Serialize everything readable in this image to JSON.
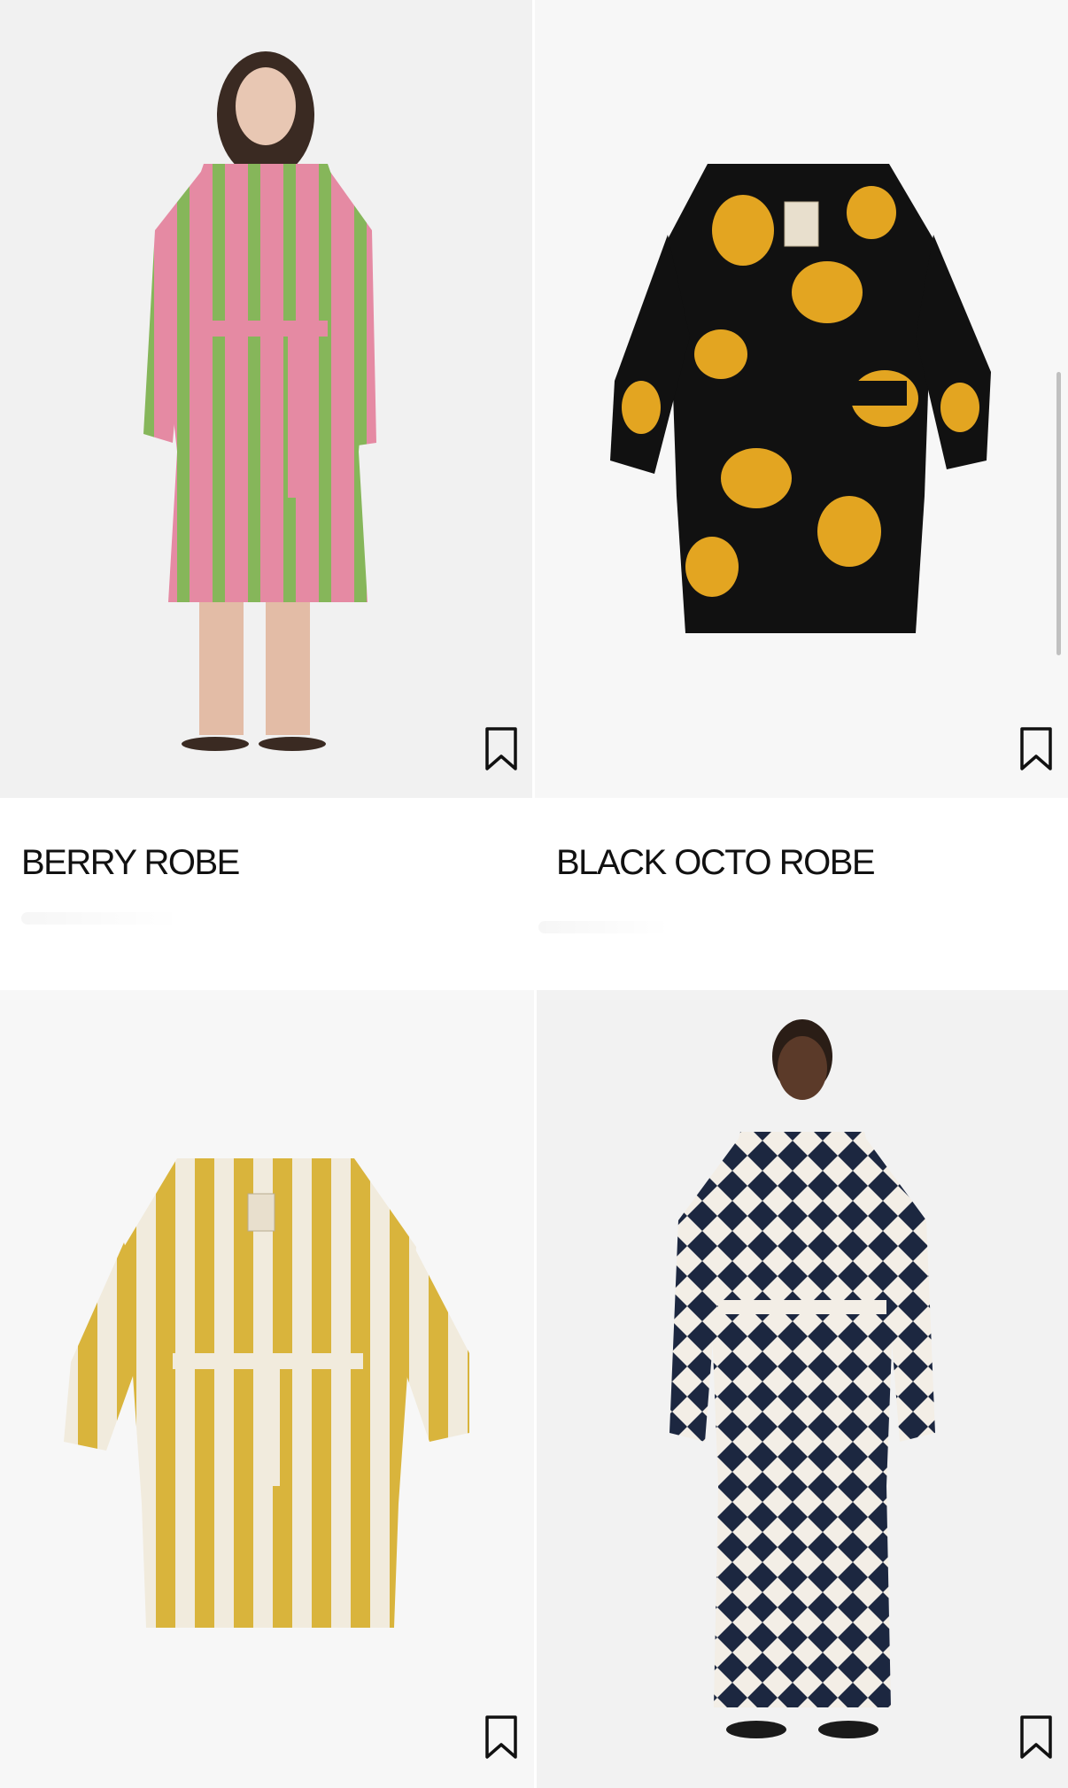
{
  "products": [
    {
      "name": "BERRY ROBE",
      "bookmark_icon": "bookmark-icon",
      "colors": [
        "#E58AA3",
        "#86B65A"
      ]
    },
    {
      "name": "BLACK OCTO ROBE",
      "bookmark_icon": "bookmark-icon",
      "colors": [
        "#111111",
        "#E3A521"
      ]
    },
    {
      "name": "",
      "bookmark_icon": "bookmark-icon",
      "colors": [
        "#D9B43C",
        "#F1EBDD"
      ]
    },
    {
      "name": "",
      "bookmark_icon": "bookmark-icon",
      "colors": [
        "#1C2740",
        "#F3EEE6"
      ]
    }
  ]
}
